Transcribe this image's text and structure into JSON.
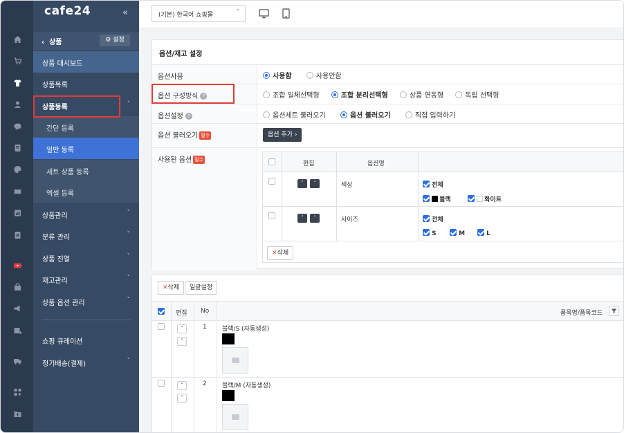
{
  "brand": "cafe24",
  "collapse_icon": "«",
  "menu": {
    "section_title": "상품",
    "settings_label": "설정",
    "items": [
      {
        "label": "상품 대시보드"
      },
      {
        "label": "상품목록"
      },
      {
        "label": "상품등록"
      },
      {
        "label": "간단 등록"
      },
      {
        "label": "일반 등록"
      },
      {
        "label": "세트 상품 등록"
      },
      {
        "label": "엑셀 등록"
      },
      {
        "label": "상품관리"
      },
      {
        "label": "분류 관리"
      },
      {
        "label": "상품 진열"
      },
      {
        "label": "재고관리"
      },
      {
        "label": "상품 옵션 관리"
      },
      {
        "label": "쇼핑 큐레이션"
      },
      {
        "label": "정기배송(결제)"
      }
    ]
  },
  "topbar": {
    "shop_select": "(기본) 한국어 쇼핑몰"
  },
  "options_panel": {
    "title": "옵션/재고 설정",
    "use_option": {
      "label": "옵션사용",
      "choices": [
        "사용함",
        "사용안함"
      ],
      "selected": "사용함"
    },
    "option_method": {
      "label": "옵션 구성방식",
      "choices": [
        "조합 일체선택형",
        "조합 분리선택형",
        "상품 연동형",
        "독립 선택형"
      ],
      "selected": "조합 분리선택형"
    },
    "option_setting": {
      "label": "옵션설정",
      "choices": [
        "옵션세트 불러오기",
        "옵션 불러오기",
        "직접 입력하기"
      ],
      "selected": "옵션 불러오기"
    },
    "load_option": {
      "label": "옵션 불러오기",
      "required": "필수",
      "button": "옵션 추가"
    },
    "used_options": {
      "label": "사용된 옵션",
      "required": "필수",
      "headers": [
        "편집",
        "옵션명"
      ],
      "rows": [
        {
          "name": "색상",
          "all_label": "전체",
          "values": [
            {
              "label": "블랙",
              "color": "#000000"
            },
            {
              "label": "화이트",
              "color": "#ffffff"
            }
          ]
        },
        {
          "name": "사이즈",
          "all_label": "전체",
          "values": [
            {
              "label": "S"
            },
            {
              "label": "M"
            },
            {
              "label": "L"
            }
          ]
        }
      ],
      "delete_button": "삭제"
    }
  },
  "product_list": {
    "delete_button": "삭제",
    "bulk_button": "일괄설정",
    "headers": {
      "edit": "편집",
      "no": "No",
      "name": "품목명/품목코드"
    },
    "rows": [
      {
        "no": "1",
        "name": "블랙/S (자동생성)",
        "color": "#000000"
      },
      {
        "no": "2",
        "name": "블랙/M (자동생성)",
        "color": "#000000"
      }
    ]
  },
  "accent_color": "#3f72d6",
  "highlight_color": "#e03b3b"
}
